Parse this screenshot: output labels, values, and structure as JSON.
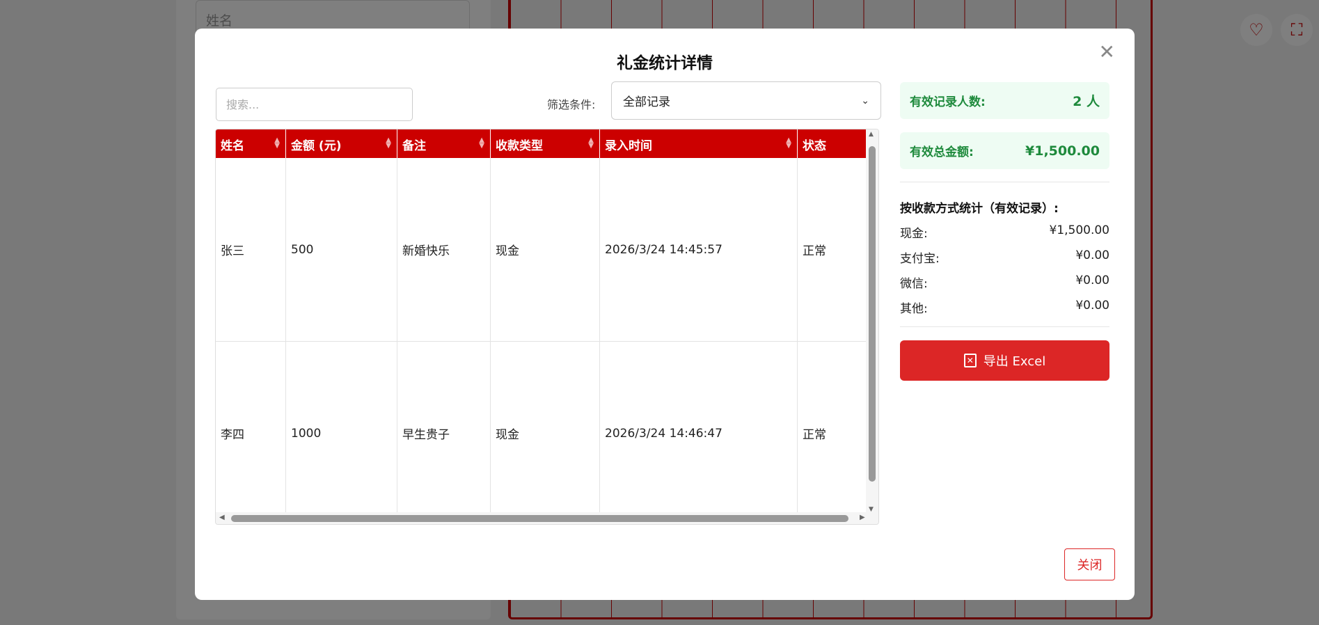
{
  "background": {
    "name_placeholder": "姓名",
    "heart_icon": "♡",
    "fullscreen_icon": "⛶"
  },
  "modal": {
    "title": "礼金统计详情",
    "close_icon": "✕",
    "search_placeholder": "搜索...",
    "filter_label": "筛选条件:",
    "filter_value": "全部记录",
    "close_button": "关闭"
  },
  "table": {
    "headers": [
      "姓名",
      "金额 (元)",
      "备注",
      "收款类型",
      "录入时间",
      "状态"
    ],
    "rows": [
      [
        "张三",
        "500",
        "新婚快乐",
        "现金",
        "2026/3/24 14:45:57",
        "正常"
      ],
      [
        "李四",
        "1000",
        "早生贵子",
        "现金",
        "2026/3/24 14:46:47",
        "正常"
      ]
    ]
  },
  "stats": {
    "valid_count_label": "有效记录人数:",
    "valid_count_value": "2 人",
    "valid_total_label": "有效总金额:",
    "valid_total_value": "¥1,500.00",
    "by_method_title": "按收款方式统计（有效记录）:",
    "methods": [
      {
        "label": "现金:",
        "value": "¥1,500.00"
      },
      {
        "label": "支付宝:",
        "value": "¥0.00"
      },
      {
        "label": "微信:",
        "value": "¥0.00"
      },
      {
        "label": "其他:",
        "value": "¥0.00"
      }
    ],
    "export_label": "导出 Excel"
  },
  "colors": {
    "header_red": "#cc0000",
    "export_red": "#dc2626",
    "stat_green": "#1e8a3c",
    "stat_bg": "#eefcf3"
  }
}
